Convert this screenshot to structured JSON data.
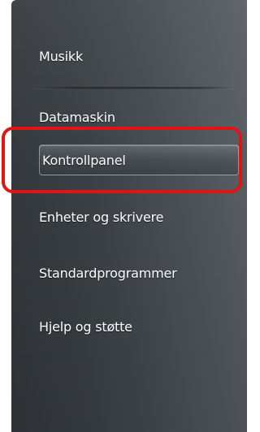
{
  "start_menu": {
    "items": [
      {
        "label": "Musikk"
      },
      {
        "label": "Datamaskin"
      },
      {
        "label": "Kontrollpanel"
      },
      {
        "label": "Enheter og skrivere"
      },
      {
        "label": "Standardprogrammer"
      },
      {
        "label": "Hjelp og støtte"
      }
    ],
    "highlighted_item": "Kontrollpanel"
  },
  "colors": {
    "pane": "#3a3f44",
    "annotation": "#e11414",
    "text": "#ffffff"
  }
}
